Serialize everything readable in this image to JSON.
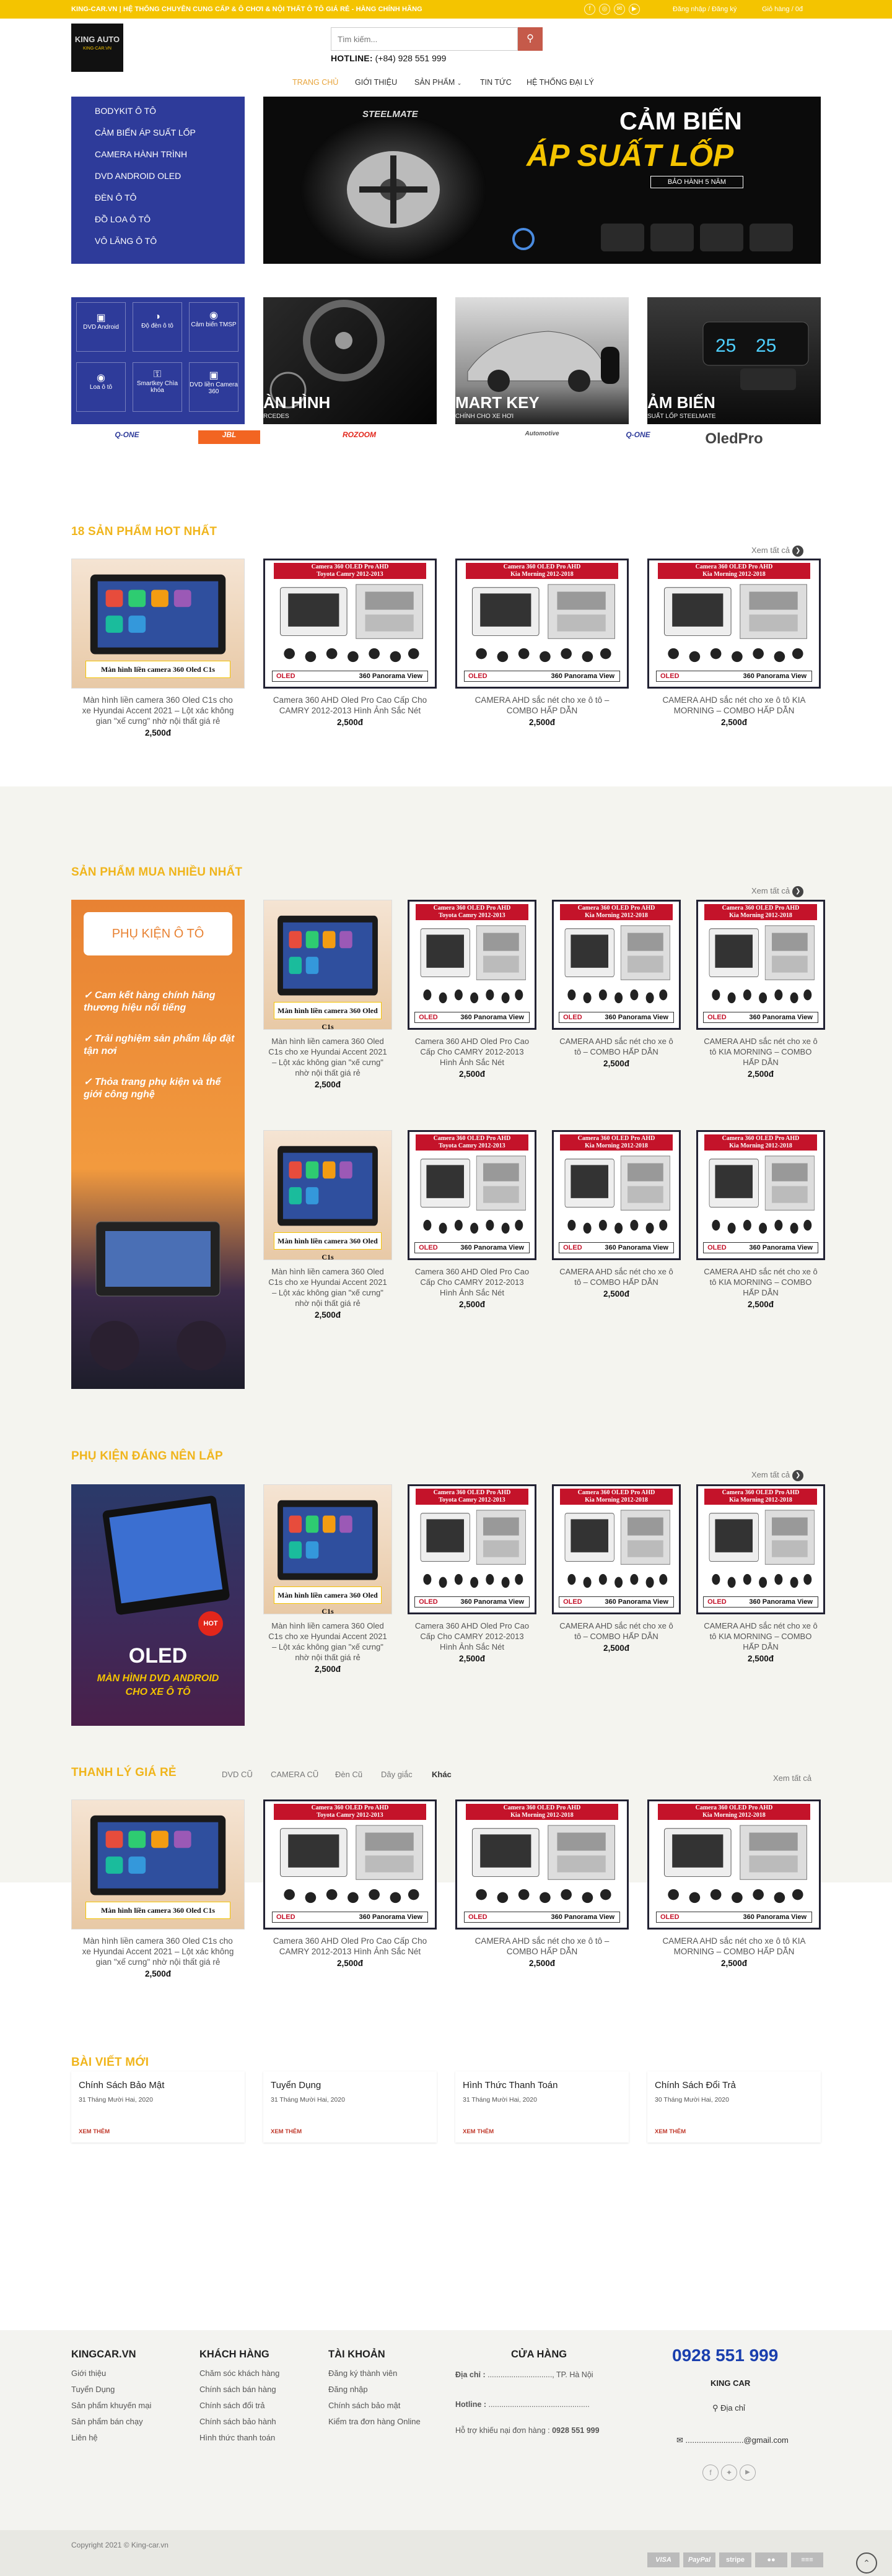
{
  "topbar": {
    "message": "KING-CAR.VN | HỆ THỐNG CHUYÊN CUNG CẤP & Ô CHƠI & NỘI THẤT Ô TÔ GIÁ RẺ - HÀNG CHÍNH HÃNG",
    "social": [
      "f",
      "◎",
      "✉",
      "▶"
    ],
    "register": "Đăng nhập / Đăng ký",
    "cart": "Giỏ hàng / 0đ"
  },
  "logo": {
    "text": "KING AUTO",
    "sub": "KING-CAR.VN"
  },
  "search": {
    "placeholder": "Tìm kiếm..."
  },
  "hotline": {
    "label": "HOTLINE:",
    "number": "(+84) 928 551 999"
  },
  "nav": [
    "TRANG CHỦ",
    "GIỚI THIỆU",
    "SẢN PHẨM",
    "TIN TỨC",
    "HỆ THỐNG ĐẠI LÝ"
  ],
  "sidemenu": [
    "BODYKIT Ô TÔ",
    "CẢM BIẾN ÁP SUẤT LỐP",
    "CAMERA HÀNH TRÌNH",
    "DVD ANDROID OLED",
    "ĐÈN Ô TÔ",
    "ĐỒ LOA Ô TÔ",
    "VÔ LĂNG Ô TÔ"
  ],
  "banner": {
    "brand": "STEELMATE",
    "title1": "CẢM BIẾN",
    "title2": "ÁP SUẤT LỐP",
    "badge": "BẢO HÀNH 5 NĂM"
  },
  "feature_chips": [
    "DVD Android",
    "Độ đèn ô tô",
    "Cảm biến TMSP",
    "Loa ô tô",
    "Smartkey Chìa khóa",
    "DVD liền Camera 360"
  ],
  "feature_cards": [
    {
      "title": "ÀN HÌNH",
      "sub": "RCEDES"
    },
    {
      "title": "MART KEY",
      "sub": "CHÍNH CHO XE HƠI"
    },
    {
      "title": "ẢM BIẾN",
      "sub": "SUẤT LỐP STEELMATE"
    }
  ],
  "brands": [
    "Q-ONE",
    "JBL",
    "ROZOOM",
    "Automotive",
    "Q-ONE",
    "OledPro"
  ],
  "products": {
    "p1": {
      "name": "Màn hình liền camera 360 Oled C1s cho xe Hyundai Accent 2021 – Lột xác không gian \"xế cưng\" nhờ nội thất giá rẻ",
      "price": "2,500đ",
      "caption": "Màn hình liền camera 360 Oled C1s"
    },
    "p2": {
      "name": "Camera 360 AHD Oled Pro Cao Cấp Cho CAMRY 2012-2013 Hình Ảnh Sắc Nét",
      "price": "2,500đ",
      "head1": "Camera 360 OLED Pro AHD",
      "head2": "Toyota Camry 2012-2013"
    },
    "p3": {
      "name": "CAMERA AHD sắc nét cho xe ô tô – COMBO HẤP DẪN",
      "price": "2,500đ",
      "head1": "Camera 360 OLED Pro AHD",
      "head2": "Kia Morning 2012-2018"
    },
    "p4": {
      "name": "CAMERA AHD sắc nét cho xe ô tô KIA MORNING – COMBO HẤP DẪN",
      "price": "2,500đ",
      "head1": "Camera 360 OLED Pro AHD",
      "head2": "Kia Morning 2012-2018"
    },
    "footer_label": "360 Panorama View",
    "oled": "OLED"
  },
  "sections": {
    "hot": "18 SẢN PHẨM HOT NHẤT",
    "buy": "SẢN PHẨM MUA NHIỀU NHẤT",
    "acc": "PHỤ KIỆN ĐÁNG NÊN LẮP",
    "sale": "THANH LÝ GIÁ RẺ",
    "blog": "BÀI VIẾT MỚI",
    "see_all": "Xem tất cả"
  },
  "promo1": {
    "pill": "PHỤ KIỆN Ô TÔ",
    "lines": [
      "Cam kết hàng chính hãng thương hiệu nổi tiếng",
      "Trải nghiệm sản phẩm lắp đặt tận nơi",
      "Thỏa trang phụ kiện và thế giới công nghệ"
    ]
  },
  "promo2": {
    "brand": "OLED",
    "line1": "MÀN HÌNH DVD ANDROID",
    "line2": "CHO XE Ô TÔ",
    "hot": "HOT"
  },
  "sale_tabs": [
    "DVD CŨ",
    "CAMERA CŨ",
    "Đèn Cũ",
    "Dây giắc",
    "Khác"
  ],
  "posts": [
    {
      "title": "Chính Sách Bảo Mật",
      "date": "31 Tháng Mười Hai, 2020",
      "more": "XEM THÊM"
    },
    {
      "title": "Tuyển Dụng",
      "date": "31 Tháng Mười Hai, 2020",
      "more": "XEM THÊM"
    },
    {
      "title": "Hình Thức Thanh Toán",
      "date": "31 Tháng Mười Hai, 2020",
      "more": "XEM THÊM"
    },
    {
      "title": "Chính Sách Đổi Trả",
      "date": "30 Tháng Mười Hai, 2020",
      "more": "XEM THÊM"
    }
  ],
  "footer": {
    "col1": {
      "title": "KINGCAR.VN",
      "links": [
        "Giới thiệu",
        "Tuyển Dụng",
        "Sản phẩm khuyến mại",
        "Sản phẩm bán chạy",
        "Liên hệ"
      ]
    },
    "col2": {
      "title": "KHÁCH HÀNG",
      "links": [
        "Chăm sóc khách hàng",
        "Chính sách bán hàng",
        "Chính sách đổi trả",
        "Chính sách bảo hành",
        "Hình thức thanh toán"
      ]
    },
    "col3": {
      "title": "TÀI KHOẢN",
      "links": [
        "Đăng ký thành viên",
        "Đăng nhập",
        "Chính sách bảo mật",
        "Kiểm tra đơn hàng Online"
      ]
    },
    "store": {
      "title": "CỬA HÀNG",
      "addr_label": "Địa chỉ :",
      "addr_dots": "..............................",
      "city": "TP. Hà Nội",
      "hotline_label": "Hotline :",
      "hotline_dots": "...............................................",
      "support": "Hỗ trợ khiếu nại đơn hàng :",
      "support_num": "0928 551 999"
    },
    "contact": {
      "phone": "0928 551 999",
      "name": "KING CAR",
      "addr": "Địa chỉ",
      "email": "..........................@gmail.com"
    },
    "copyright": "Copyright 2021 © King-car.vn",
    "payments": [
      "VISA",
      "PayPal",
      "stripe",
      "●●",
      "≡≡≡"
    ]
  },
  "colors": {
    "accent": "#f4c400",
    "title": "#f0b51c",
    "menu": "#2e3b9a",
    "link_blue": "#1a3fae"
  }
}
